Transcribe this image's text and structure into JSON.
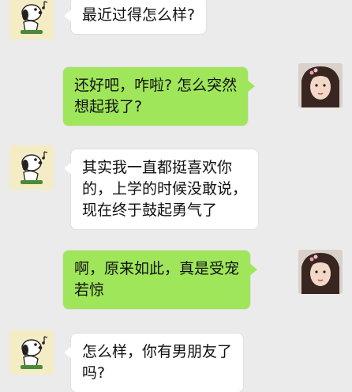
{
  "messages": [
    {
      "side": "left",
      "lines": [
        "最近过得怎么样?"
      ]
    },
    {
      "side": "right",
      "lines": [
        "还好吧，咋啦? 怎么突然",
        "想起我了?"
      ]
    },
    {
      "side": "left",
      "lines": [
        "其实我一直都挺喜欢你",
        "的，上学的时候没敢说，",
        "现在终于鼓起勇气了"
      ]
    },
    {
      "side": "right",
      "lines": [
        "啊，原来如此，真是受宠",
        "若惊"
      ]
    },
    {
      "side": "left",
      "lines": [
        "怎么样，你有男朋友了",
        "吗?"
      ]
    }
  ],
  "avatars": {
    "left_icon": "snoopy-dog-avatar-icon",
    "right_icon": "girl-photo-avatar-icon"
  },
  "colors": {
    "background": "#ebebeb",
    "bubble_left": "#ffffff",
    "bubble_right": "#9fe65a"
  }
}
